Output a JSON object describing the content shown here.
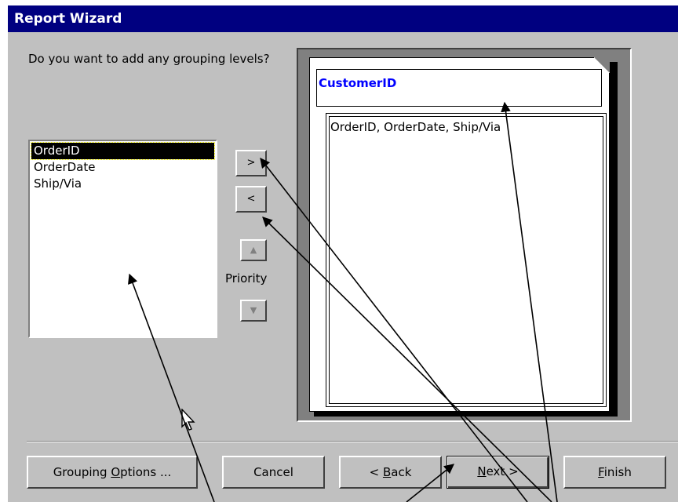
{
  "window": {
    "title": "Report Wizard"
  },
  "prompt": {
    "text": "Do you want to add any grouping levels?"
  },
  "fields": {
    "items": [
      {
        "label": "OrderID",
        "selected": true
      },
      {
        "label": "OrderDate",
        "selected": false
      },
      {
        "label": "Ship/Via",
        "selected": false
      }
    ]
  },
  "shuttle": {
    "add_label": ">",
    "remove_label": "<",
    "priority_label": "Priority"
  },
  "preview": {
    "group_field": "CustomerID",
    "detail_fields": "OrderID, OrderDate, Ship/Via"
  },
  "buttons": {
    "grouping_options": {
      "before": "Grouping ",
      "key": "O",
      "after": "ptions ..."
    },
    "cancel": "Cancel",
    "back": {
      "before": "< ",
      "key": "B",
      "after": "ack"
    },
    "next": {
      "before": "",
      "key": "N",
      "after": "ext >"
    },
    "finish": {
      "before": "",
      "key": "F",
      "after": "inish"
    }
  },
  "colors": {
    "title_bar": "#000080",
    "dialog_bg": "#c0c0c0",
    "group_field_text": "#0000ff"
  }
}
